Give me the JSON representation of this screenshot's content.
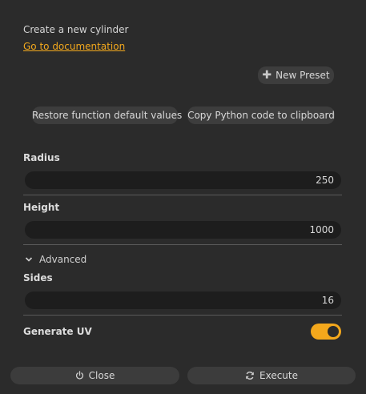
{
  "header": {
    "description": "Create a new cylinder",
    "doc_link": "Go to documentation"
  },
  "presets": {
    "new_preset_label": "New Preset",
    "new_preset_icon": "plus-icon"
  },
  "actions": {
    "restore_label": "Restore function default values",
    "copy_label": "Copy Python code to clipboard"
  },
  "fields": {
    "radius": {
      "label": "Radius",
      "value": "250"
    },
    "height": {
      "label": "Height",
      "value": "1000"
    },
    "advanced_label": "Advanced",
    "sides": {
      "label": "Sides",
      "value": "16"
    },
    "generate_uv": {
      "label": "Generate UV",
      "enabled": true
    }
  },
  "footer": {
    "close_label": "Close",
    "close_icon": "power-icon",
    "execute_label": "Execute",
    "execute_icon": "refresh-icon"
  },
  "colors": {
    "accent": "#f4a81c",
    "background": "#2b2b2b",
    "field_bg": "#1d1d1d",
    "button_bg": "#3d3d3d"
  }
}
